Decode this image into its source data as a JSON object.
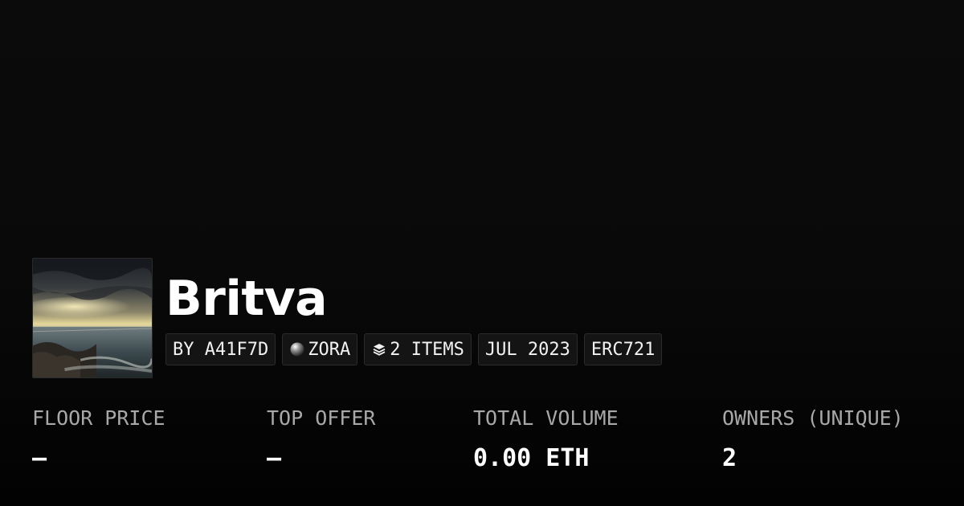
{
  "collection": {
    "title": "Britva",
    "thumbnail_icon": "stormy-seascape-image"
  },
  "tags": [
    {
      "label": "BY A41F7D",
      "icon": ""
    },
    {
      "label": "ZORA",
      "icon": "zora-orb-icon"
    },
    {
      "label": "2 ITEMS",
      "icon": "layers-icon"
    },
    {
      "label": "JUL 2023",
      "icon": ""
    },
    {
      "label": "ERC721",
      "icon": ""
    }
  ],
  "stats": [
    {
      "label": "FLOOR PRICE",
      "value": "–"
    },
    {
      "label": "TOP OFFER",
      "value": "–"
    },
    {
      "label": "TOTAL VOLUME",
      "value": "0.00 ETH"
    },
    {
      "label": "OWNERS (UNIQUE)",
      "value": "2"
    }
  ],
  "colors": {
    "background": "#0a0a0a",
    "label": "#a8a8a8",
    "value": "#ffffff",
    "tag_bg": "#141414",
    "tag_border": "#2b2b2b"
  }
}
